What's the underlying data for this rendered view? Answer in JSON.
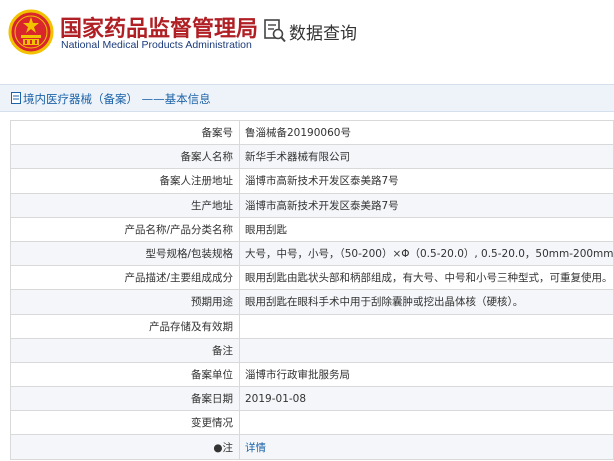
{
  "header": {
    "brand_cn": "国家药品监督管理局",
    "brand_en": "National Medical Products Administration",
    "query_label": "数据查询"
  },
  "breadcrumb": {
    "text": "境内医疗器械（备案） ——基本信息"
  },
  "rows": [
    {
      "label": "备案号",
      "value": "鲁淄械备20190060号"
    },
    {
      "label": "备案人名称",
      "value": "新华手术器械有限公司"
    },
    {
      "label": "备案人注册地址",
      "value": "淄博市高新技术开发区泰美路7号"
    },
    {
      "label": "生产地址",
      "value": "淄博市高新技术开发区泰美路7号"
    },
    {
      "label": "产品名称/产品分类名称",
      "value": "眼用刮匙"
    },
    {
      "label": "型号规格/包装规格",
      "value": "大号，中号，小号，（50-200）×Φ（0.5-20.0）, 0.5-20.0，50mm-200mm"
    },
    {
      "label": "产品描述/主要组成成分",
      "value": "眼用刮匙由匙状头部和柄部组成，有大号、中号和小号三种型式，可重复使用。"
    },
    {
      "label": "预期用途",
      "value": "眼用刮匙在眼科手术中用于刮除囊肿或挖出晶体核（硬核）。"
    },
    {
      "label": "产品存储及有效期",
      "value": ""
    },
    {
      "label": "备注",
      "value": ""
    },
    {
      "label": "备案单位",
      "value": "淄博市行政审批服务局"
    },
    {
      "label": "备案日期",
      "value": "2019-01-08"
    },
    {
      "label": "变更情况",
      "value": ""
    },
    {
      "label": "●注",
      "value": "详情"
    }
  ],
  "colors": {
    "brand_red": "#b01f24",
    "brand_blue": "#1a3a7a",
    "link_blue": "#1d63a8",
    "emblem_gold": "#f2c200",
    "emblem_red": "#d8262c"
  },
  "icons": {
    "emblem": "national-emblem-icon",
    "query": "document-search-icon",
    "crumb": "document-icon"
  }
}
